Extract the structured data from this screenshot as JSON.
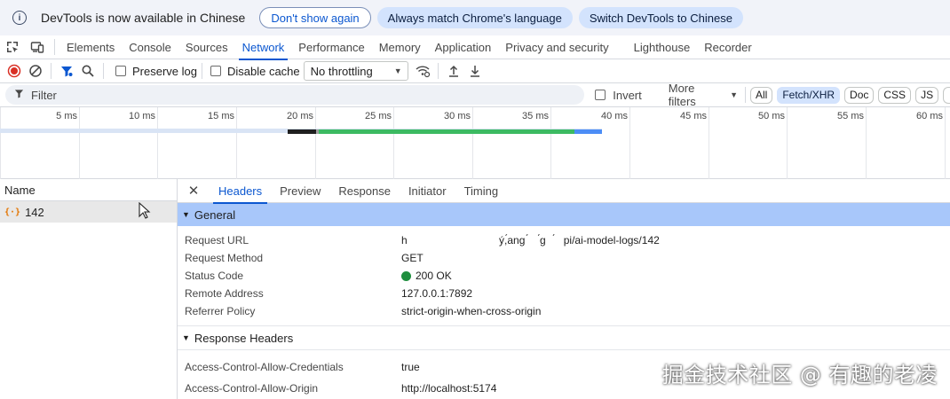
{
  "infobar": {
    "message": "DevTools is now available in Chinese",
    "btn_dont_show": "Don't show again",
    "btn_match": "Always match Chrome's language",
    "btn_switch": "Switch DevTools to Chinese"
  },
  "tabs": [
    "Elements",
    "Console",
    "Sources",
    "Network",
    "Performance",
    "Memory",
    "Application",
    "Privacy and security",
    "Lighthouse",
    "Recorder"
  ],
  "active_tab": "Network",
  "toolbar": {
    "preserve_log": "Preserve log",
    "disable_cache": "Disable cache",
    "throttling": "No throttling"
  },
  "filter": {
    "placeholder": "Filter",
    "invert": "Invert",
    "more_filters": "More filters",
    "chips": [
      "All",
      "Fetch/XHR",
      "Doc",
      "CSS",
      "JS"
    ]
  },
  "timeline": {
    "ticks": [
      "5 ms",
      "10 ms",
      "15 ms",
      "20 ms",
      "25 ms",
      "30 ms",
      "35 ms",
      "40 ms",
      "45 ms",
      "50 ms",
      "55 ms",
      "60 ms"
    ]
  },
  "requests": {
    "header": "Name",
    "rows": [
      {
        "name": "142"
      }
    ]
  },
  "details": {
    "tabs": [
      "Headers",
      "Preview",
      "Response",
      "Initiator",
      "Timing"
    ],
    "general_title": "General",
    "general": [
      {
        "key": "Request URL",
        "value": "h                               ý,́ang ́    ́g   ́   pi/ai-model-logs/142"
      },
      {
        "key": "Request Method",
        "value": "GET"
      },
      {
        "key": "Status Code",
        "value": "200 OK"
      },
      {
        "key": "Remote Address",
        "value": "127.0.0.1:7892"
      },
      {
        "key": "Referrer Policy",
        "value": "strict-origin-when-cross-origin"
      }
    ],
    "response_title": "Response Headers",
    "response": [
      {
        "key": "Access-Control-Allow-Credentials",
        "value": "true"
      },
      {
        "key": "Access-Control-Allow-Origin",
        "value": "http://localhost:5174"
      }
    ]
  },
  "watermark": "掘金技术社区 @ 有趣的老凌",
  "colors": {
    "accent": "#0b57d0",
    "status_ok": "#1e8e3e",
    "record": "#d93025",
    "section_highlight": "#a8c7fa"
  }
}
